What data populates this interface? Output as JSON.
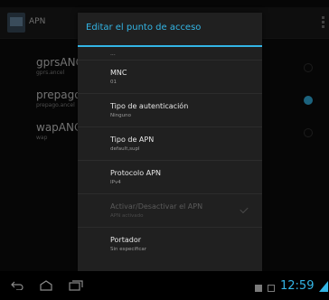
{
  "app_bar": {
    "title": "APN"
  },
  "background_list": [
    {
      "name": "gprsANCEL",
      "sub": "gprs.ancel"
    },
    {
      "name": "prepagoANCEL",
      "sub": "prepago.ancel"
    },
    {
      "name": "wapANCEL",
      "sub": "wap"
    }
  ],
  "dialog": {
    "title": "Editar el punto de acceso",
    "partial_value": "...",
    "prefs": [
      {
        "title": "MNC",
        "summary": "01",
        "enabled": true
      },
      {
        "title": "Tipo de autenticación",
        "summary": "Ninguno",
        "enabled": true
      },
      {
        "title": "Tipo de APN",
        "summary": "default,supl",
        "enabled": true
      },
      {
        "title": "Protocolo APN",
        "summary": "IPv4",
        "enabled": true
      },
      {
        "title": "Activar/Desactivar el APN",
        "summary": "APN activado",
        "enabled": false,
        "checked": true
      },
      {
        "title": "Portador",
        "summary": "Sin especificar",
        "enabled": true
      }
    ]
  },
  "status_bar": {
    "time": "12:59"
  },
  "colors": {
    "accent": "#33b5e5",
    "dialog_bg": "#202020",
    "background": "#0c0c0c"
  },
  "icons": [
    "back-icon",
    "home-icon",
    "recent-apps-icon",
    "notification-icon",
    "signal-icon"
  ]
}
